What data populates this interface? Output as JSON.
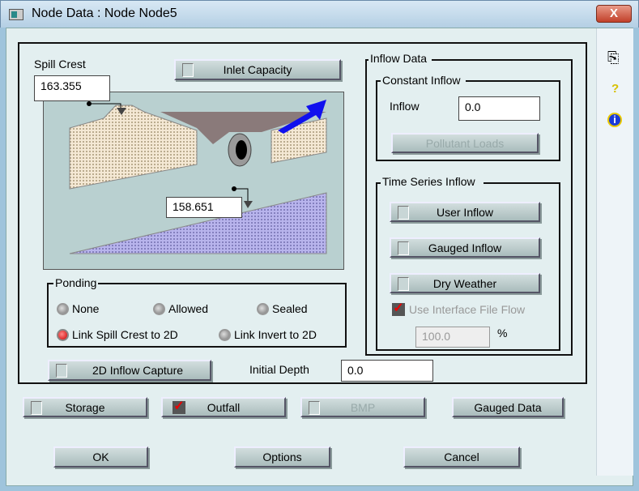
{
  "window": {
    "title": "Node Data : Node Node5",
    "close": "X"
  },
  "spill_crest": {
    "label": "Spill Crest",
    "value": "163.355"
  },
  "invert": {
    "value": "158.651"
  },
  "inlet_capacity": {
    "label": "Inlet Capacity",
    "checked": false
  },
  "ponding": {
    "label": "Ponding",
    "options": [
      "None",
      "Allowed",
      "Sealed",
      "Link Spill Crest to 2D",
      "Link Invert to 2D"
    ],
    "selected": "Link Spill Crest to 2D"
  },
  "inflow_capture": {
    "label": "2D Inflow Capture",
    "checked": false
  },
  "initial_depth": {
    "label": "Initial Depth",
    "value": "0.0"
  },
  "inflow_data": {
    "label": "Inflow Data",
    "constant": {
      "label": "Constant Inflow",
      "inflow_label": "Inflow",
      "inflow_value": "0.0",
      "pollutant_loads": "Pollutant Loads"
    },
    "time_series": {
      "label": "Time Series Inflow",
      "user_inflow": "User Inflow",
      "gauged_inflow": "Gauged Inflow",
      "dry_weather": "Dry Weather",
      "use_interface": "Use Interface File Flow",
      "interface_value": "100.0",
      "percent": "%"
    }
  },
  "bottom": {
    "storage": "Storage",
    "outfall": "Outfall",
    "bmp": "BMP",
    "gauged_data": "Gauged Data",
    "ok": "OK",
    "options": "Options",
    "cancel": "Cancel"
  },
  "sidebar": {
    "help": "?",
    "info": "i"
  }
}
